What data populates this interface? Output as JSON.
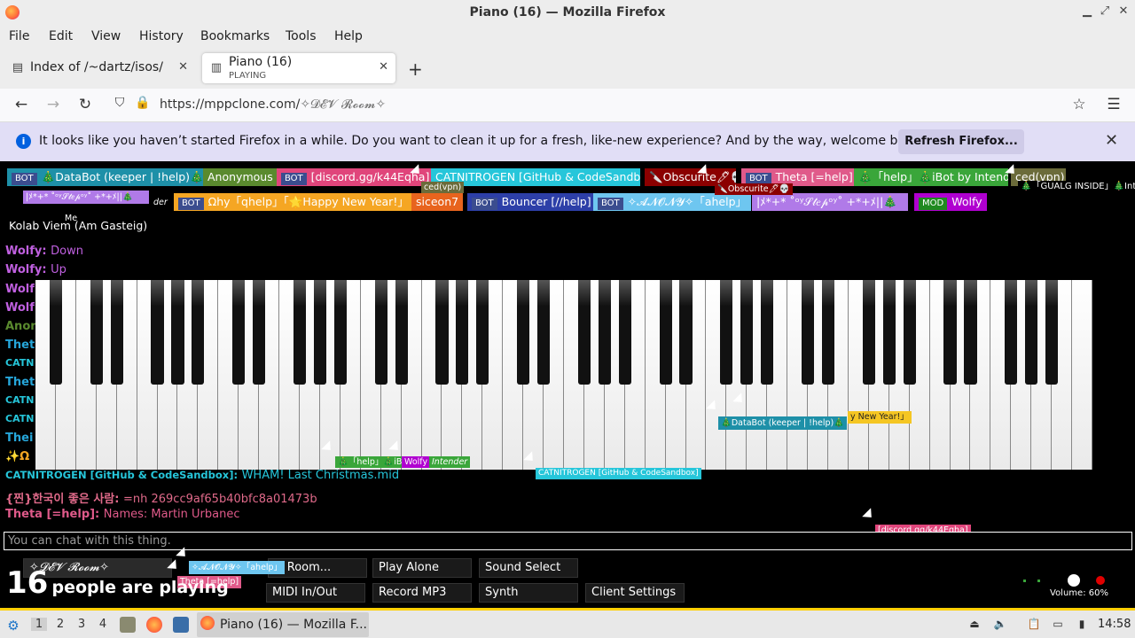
{
  "window": {
    "title": "Piano (16) — Mozilla Firefox"
  },
  "menu": [
    "File",
    "Edit",
    "View",
    "History",
    "Bookmarks",
    "Tools",
    "Help"
  ],
  "tabs": [
    {
      "title": "Index of /~dartz/isos/",
      "subtitle": ""
    },
    {
      "title": "Piano (16)",
      "subtitle": "PLAYING"
    }
  ],
  "address": {
    "base": "https://mppclone.com/",
    "path": "✧𝓓𝓔𝓥 𝓡𝓸𝓸𝓶✧"
  },
  "notification": {
    "message": "It looks like you haven’t started Firefox in a while. Do you want to clean it up for a fresh, like-new experience? And by the way, welcome back!",
    "button": "Refresh Firefox..."
  },
  "participants_row1": [
    {
      "badge": "BOT",
      "name": "🎄DataBot (keeper | !help)🎄",
      "color": "#1e90a8"
    },
    {
      "badge": "",
      "name": "Anonymous",
      "color": "#5a8a2e"
    },
    {
      "badge": "BOT",
      "name": "[discord.gg/k44Eqha]",
      "color": "#e0457b"
    },
    {
      "badge": "",
      "name": "CATNITROGEN [GitHub & CodeSandbox]",
      "color": "#26c6da"
    },
    {
      "badge": "",
      "name": "🔪Obscurite🖊💀",
      "color": "#8b0000"
    },
    {
      "badge": "BOT",
      "name": "Theta [=help]",
      "color": "#e05a8a"
    },
    {
      "badge": "",
      "name": "🎄「help」🎄iBot by Intender",
      "color": "#3aa63a"
    },
    {
      "badge": "",
      "name": "ced(vpn)",
      "color": "#6b6b3a"
    }
  ],
  "participants_row2": [
    {
      "badge": "BOT",
      "name": "Ωhy「qhelp」「🌟Happy New Year!」",
      "color": "#f5a623"
    },
    {
      "badge": "",
      "name": "siceon7",
      "color": "#e8641e"
    },
    {
      "badge": "BOT",
      "name": "Bouncer [//help]",
      "color": "#2d3fa8"
    },
    {
      "badge": "BOT",
      "name": "✧𝓐𝓝𝓞𝓝𝓨✧「ahelp」",
      "color": "#6ec6f0"
    },
    {
      "badge": "",
      "name": "|ﾒ*+* ˚ᵒʸ𝒮𝓉𝑒𝓅ᵒʸ˚ +*+ﾒ||🎄",
      "color": "#b07ae8"
    },
    {
      "badge": "MOD",
      "name": "Wolfy",
      "color": "#b000d0"
    }
  ],
  "floating_labels": {
    "stepper": "|ﾒ*+* ˚ᵒʸ𝒮𝓉𝑒𝓅ᵒʸ˚ +*+ﾒ||🎄",
    "ced": "ced(vpn)",
    "obscurite": "🔪Obscurite🖊💀",
    "gualg": "🎄「GUALG INSIDE」🎄Inter",
    "me": "Me",
    "kolab": "Kolab Viem (Am Gasteig)",
    "der": "der",
    "databot": "🎄DataBot (keeper | !help)🎄",
    "newyear": "y New Year!」",
    "help_ibot": "🎄「help」🎄iB",
    "wolfy": "Wolfy",
    "intender": "Intender",
    "catnitrogen": "CATNITROGEN [GitHub & CodeSandbox]",
    "discord": "[discord.gg/k44Eqha]",
    "room_cursor": "✧𝓓𝓔𝓥 𝓡𝓸𝓸𝓶✧",
    "anony_cursor": "✧𝓐𝓝𝓞𝓝𝓨✧「ahelp」",
    "theta_cursor": "Theta [=help]"
  },
  "chat": [
    {
      "name": "Wolfy:",
      "msg": "Down",
      "color": "#c060e0"
    },
    {
      "name": "Wolfy:",
      "msg": "Up",
      "color": "#c060e0"
    }
  ],
  "chat_partial_names": [
    {
      "text": "Wolf",
      "color": "#c060e0"
    },
    {
      "text": "Wolf",
      "color": "#c060e0"
    },
    {
      "text": "Anon",
      "color": "#5a8a2e"
    },
    {
      "text": "Thet",
      "color": "#26a6da"
    },
    {
      "text": "CATN",
      "color": "#26c6da"
    },
    {
      "text": "Thet",
      "color": "#26a6da"
    },
    {
      "text": "CATN",
      "color": "#26c6da"
    },
    {
      "text": "CATN",
      "color": "#26c6da"
    },
    {
      "text": "Thei",
      "color": "#26a6da"
    },
    {
      "text": "✨Ω",
      "color": "#f5a623"
    }
  ],
  "chat_bottom": [
    {
      "name": "CATNITROGEN [GitHub & CodeSandbox]:",
      "msg": "WHAM! Last Christmas.mid",
      "color": "#26c6da"
    },
    {
      "name": "{찐}한국이 좋은 사람:",
      "msg": "=nh 269cc9af65b40bfc8a01473b",
      "color": "#e06a8a"
    },
    {
      "name": "Theta [=help]:",
      "msg": "Names: Martin Urbanec",
      "color": "#e05a8a"
    }
  ],
  "chat_input": {
    "placeholder": "You can chat with this thing."
  },
  "room_button": "✧𝓓𝓔𝓥 𝓡𝓸𝓸𝓶✧",
  "buttons": {
    "new_room": "w Room...",
    "play_alone": "Play Alone",
    "sound_select": "Sound Select",
    "midi": "MIDI In/Out",
    "record": "Record MP3",
    "synth": "Synth",
    "client_settings": "Client Settings"
  },
  "people": {
    "count": "16",
    "label": "people are playing"
  },
  "volume": {
    "label": "Volume: 60%",
    "level": 0.6
  },
  "taskbar": {
    "workspaces": [
      "1",
      "2",
      "3",
      "4"
    ],
    "active_workspace": "1",
    "task_title": "Piano (16) — Mozilla F...",
    "clock": "14:58"
  },
  "colors": {
    "accent": "#ffcf00",
    "notice_bg": "#e1def6",
    "brand": "#ff7139"
  }
}
